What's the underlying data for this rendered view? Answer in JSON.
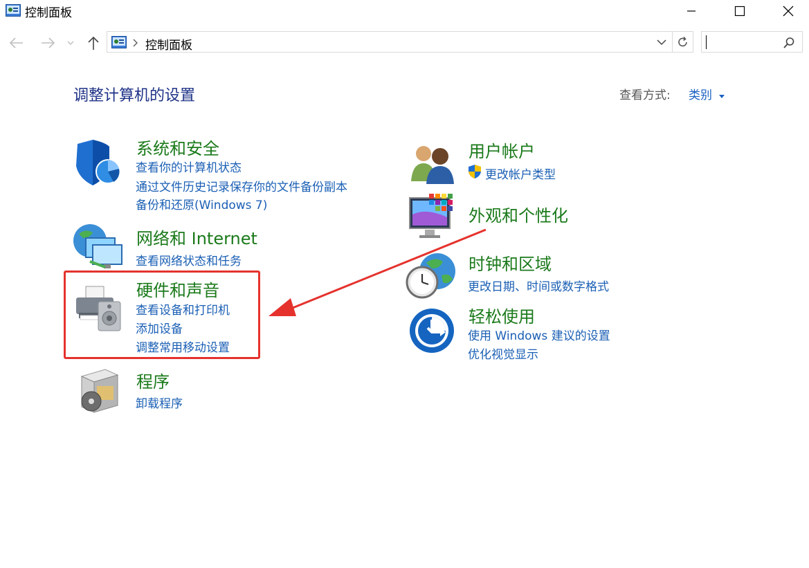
{
  "window": {
    "title": "控制面板",
    "icon": "control-panel-icon"
  },
  "addressbar": {
    "breadcrumb": "控制面板",
    "search_placeholder": ""
  },
  "header": {
    "page_title": "调整计算机的设置",
    "view_label": "查看方式:",
    "view_value": "类别"
  },
  "categories": {
    "system_security": {
      "title": "系统和安全",
      "links": [
        "查看你的计算机状态",
        "通过文件历史记录保存你的文件备份副本",
        "备份和还原(Windows 7)"
      ]
    },
    "network": {
      "title": "网络和 Internet",
      "links": [
        "查看网络状态和任务"
      ]
    },
    "hardware_sound": {
      "title": "硬件和声音",
      "links": [
        "查看设备和打印机",
        "添加设备",
        "调整常用移动设置"
      ]
    },
    "programs": {
      "title": "程序",
      "links": [
        "卸载程序"
      ]
    },
    "user_accounts": {
      "title": "用户帐户",
      "links": [
        "更改帐户类型"
      ]
    },
    "appearance": {
      "title": "外观和个性化",
      "links": []
    },
    "clock_region": {
      "title": "时钟和区域",
      "links": [
        "更改日期、时间或数字格式"
      ]
    },
    "ease_of_access": {
      "title": "轻松使用",
      "links": [
        "使用 Windows 建议的设置",
        "优化视觉显示"
      ]
    }
  },
  "colors": {
    "title_blue": "#1e3287",
    "category_green": "#1b7a1b",
    "link_blue": "#1a5fb4",
    "annotation_red": "#e5322d"
  }
}
